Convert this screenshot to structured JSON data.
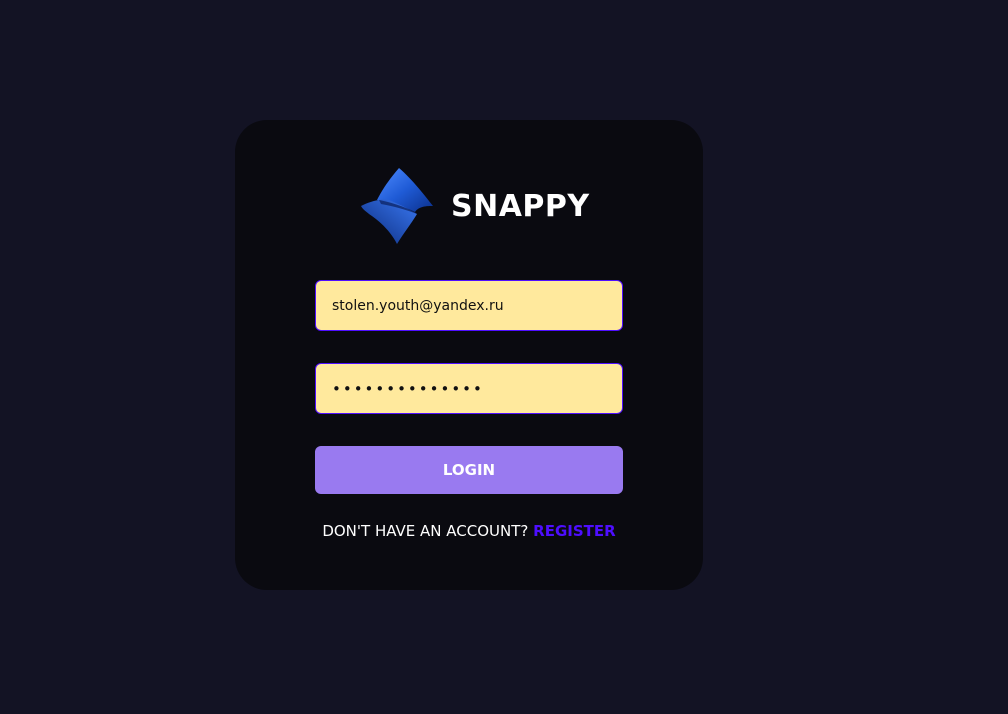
{
  "brand": {
    "name": "SNAPPY",
    "logo_icon": "snappy-logo-icon",
    "logo_color": "#1f5bd6"
  },
  "login_form": {
    "email_value": "stolen.youth@yandex.ru",
    "password_value": "••••••••••••••",
    "submit_label": "LOGIN"
  },
  "footer": {
    "prompt": "DON'T HAVE AN ACCOUNT?",
    "register_label": "REGISTER"
  },
  "colors": {
    "page_background": "#131324",
    "card_background": "#0a0a10",
    "input_background": "#ffe99d",
    "input_border": "#4e0eff",
    "button_background": "#997af0",
    "link": "#4e0eff"
  }
}
